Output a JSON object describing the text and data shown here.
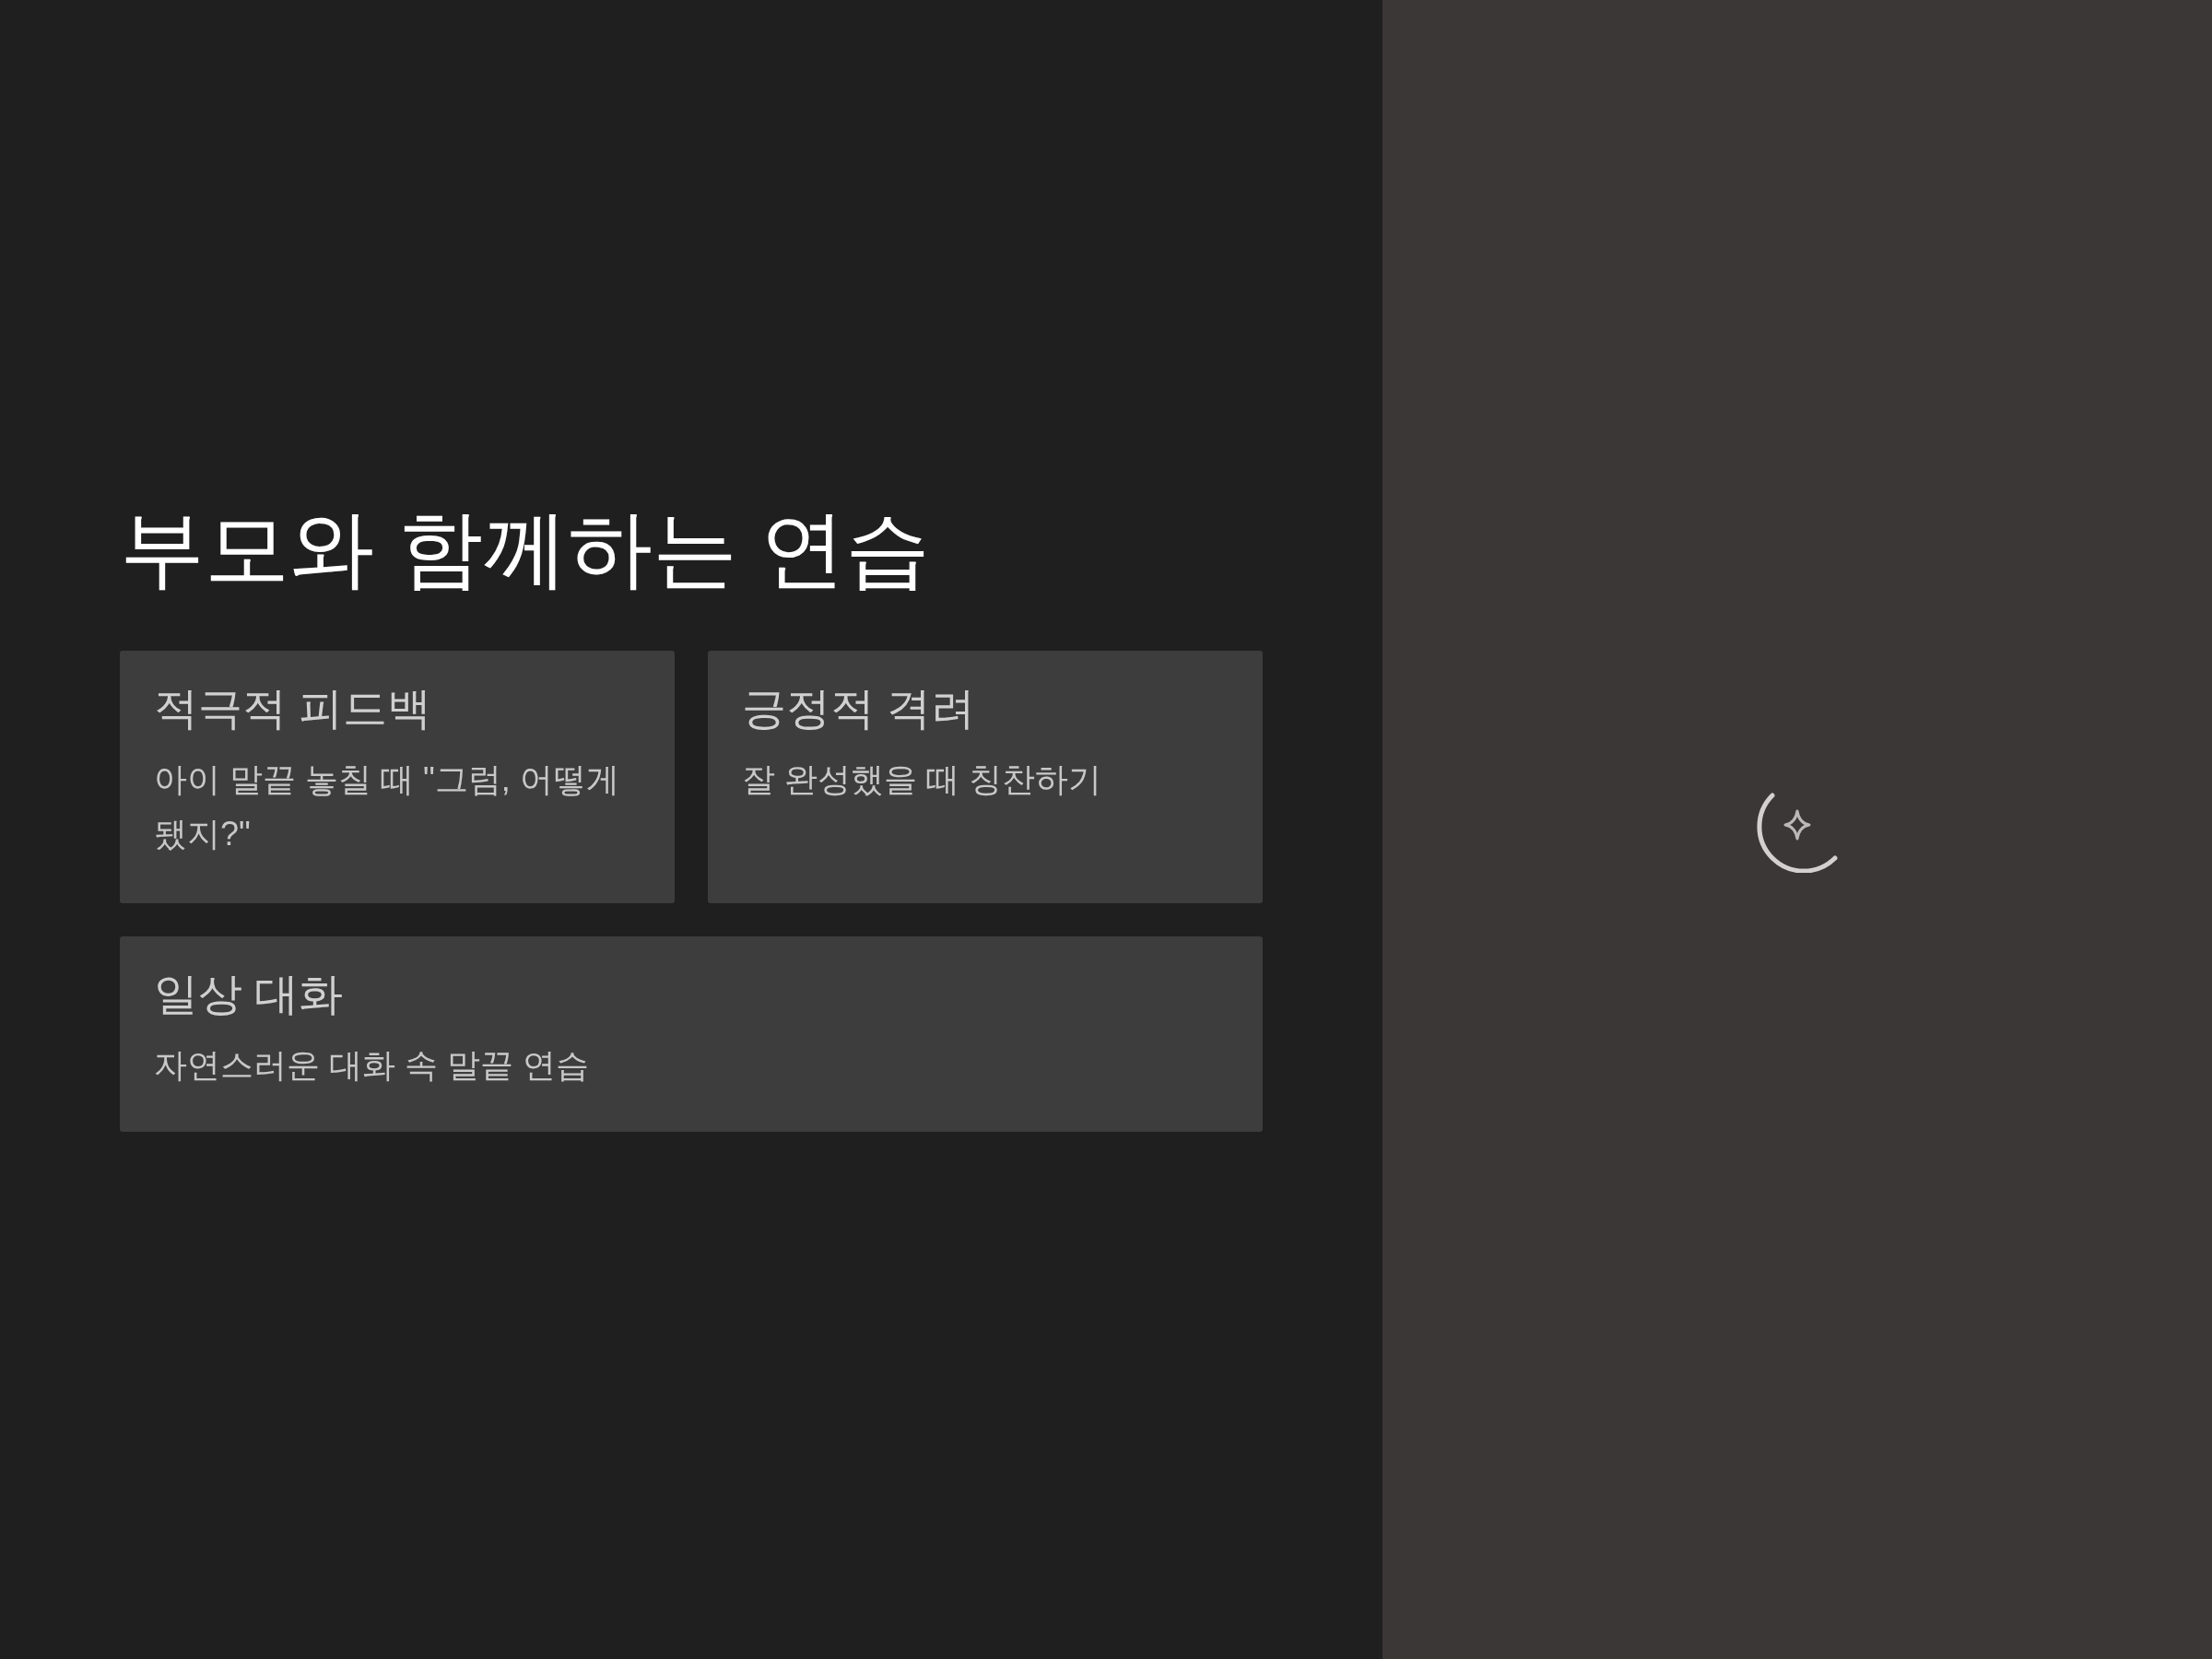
{
  "main": {
    "title": "부모와 함께하는 연습",
    "cards": [
      {
        "title": "적극적 피드백",
        "description": "아이 말끝 놓칠 때 \"그럼, 어떻게 됐지?\""
      },
      {
        "title": "긍정적 격려",
        "description": "잘 완성했을 때 칭찬하기"
      },
      {
        "title": "일상 대화",
        "description": "자연스러운 대화 속 말끝 연습"
      }
    ]
  }
}
